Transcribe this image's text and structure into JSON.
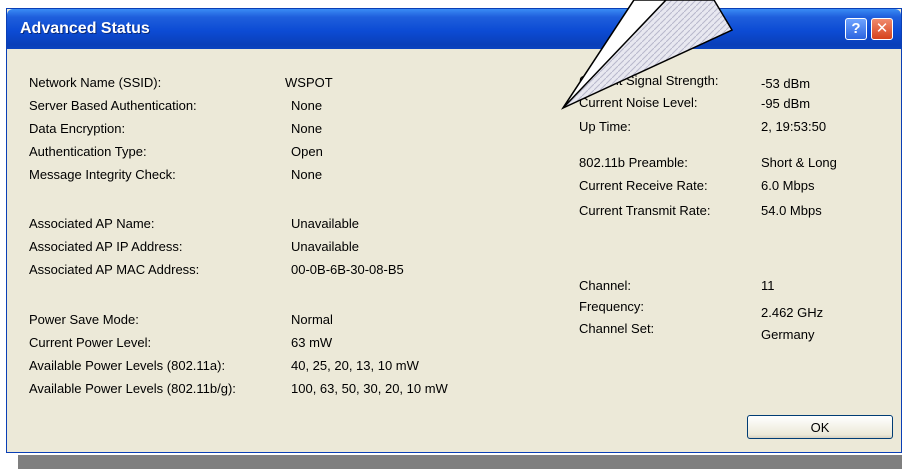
{
  "window": {
    "title": "Advanced Status",
    "help_glyph": "?",
    "close_glyph": "✕"
  },
  "left": [
    {
      "label": "Network Name (SSID):",
      "value": "WSPOT"
    },
    {
      "label": "Server Based Authentication:",
      "value": "None"
    },
    {
      "label": "Data Encryption:",
      "value": "None"
    },
    {
      "label": "Authentication Type:",
      "value": "Open"
    },
    {
      "label": "Message Integrity Check:",
      "value": "None"
    },
    {
      "label": "Associated AP Name:",
      "value": "Unavailable"
    },
    {
      "label": "Associated AP IP Address:",
      "value": "Unavailable"
    },
    {
      "label": "Associated AP MAC Address:",
      "value": "00-0B-6B-30-08-B5"
    },
    {
      "label": "Power Save Mode:",
      "value": "Normal"
    },
    {
      "label": "Current Power Level:",
      "value": "63 mW"
    },
    {
      "label": "Available Power Levels (802.11a):",
      "value": "40, 25, 20, 13, 10 mW"
    },
    {
      "label": "Available Power Levels (802.11b/g):",
      "value": "100, 63, 50, 30, 20, 10 mW"
    }
  ],
  "right": [
    {
      "label": "Current Signal Strength:",
      "value": "-53 dBm"
    },
    {
      "label": "Current Noise Level:",
      "value": "-95 dBm"
    },
    {
      "label": "Up Time:",
      "value": "2, 19:53:50"
    },
    {
      "label": "802.11b Preamble:",
      "value": "Short & Long"
    },
    {
      "label": "Current Receive Rate:",
      "value": "6.0 Mbps"
    },
    {
      "label": "Current Transmit Rate:",
      "value": "54.0 Mbps"
    },
    {
      "label": "Channel:",
      "value": "11"
    },
    {
      "label": "Frequency:",
      "value": "2.462 GHz"
    },
    {
      "label": "Channel Set:",
      "value": "Germany"
    }
  ],
  "buttons": {
    "ok_label": "OK"
  },
  "colors": {
    "titlebar": "#0c4bd4",
    "dialog_bg": "#ece9d8",
    "close": "#d6421c",
    "help": "#2b64e0"
  }
}
